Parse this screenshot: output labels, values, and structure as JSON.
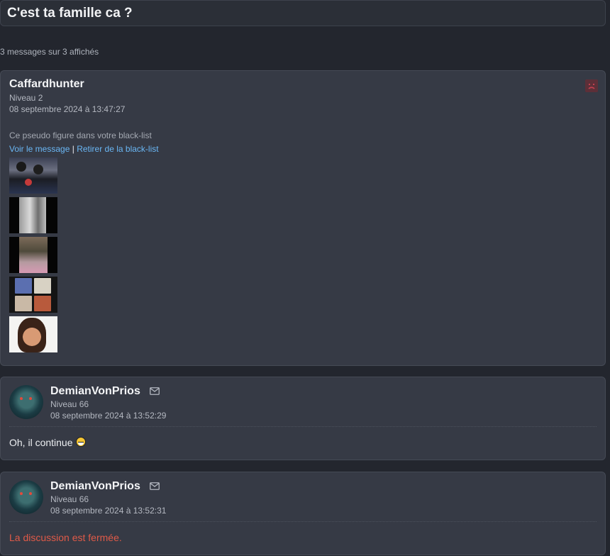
{
  "topic": {
    "title": "C'est ta famille ca ?"
  },
  "message_count": "3 messages sur 3 affichés",
  "posts": [
    {
      "author": "Caffardhunter",
      "level": "Niveau 2",
      "date": "08 septembre 2024 à 13:47:27",
      "blacklist_notice": "Ce pseudo figure dans votre black-list",
      "view_link": "Voir le message",
      "separator": "|",
      "remove_link": "Retirer de la black-list",
      "icon": "sad-face-icon"
    },
    {
      "author": "DemianVonPrios",
      "level": "Niveau 66",
      "date": "08 septembre 2024 à 13:52:29",
      "message": "Oh, il continue",
      "icon": "mail-icon"
    },
    {
      "author": "DemianVonPrios",
      "level": "Niveau 66",
      "date": "08 septembre 2024 à 13:52:31",
      "message": "La discussion est fermée.",
      "icon": "mail-icon"
    }
  ],
  "colors": {
    "background": "#23262e",
    "card": "#363a45",
    "link": "#6ab7f5",
    "closed": "#e05a48"
  }
}
